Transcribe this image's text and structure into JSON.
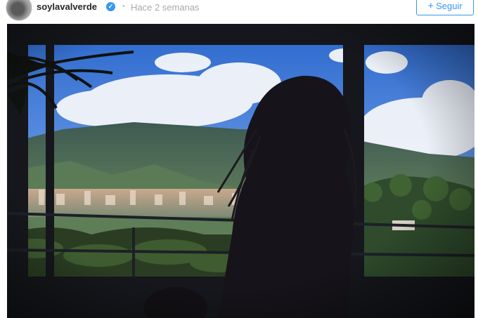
{
  "post": {
    "username": "soylavalverde",
    "verified": true,
    "separator": "•",
    "timestamp": "Hace 2 semanas",
    "follow_label": "Seguir",
    "follow_icon": "plus-icon"
  },
  "photo": {
    "subject": "silhouette-of-woman-at-window",
    "colors": {
      "sky_top": "#2f6fd3",
      "sky_bottom": "#8ab4ef",
      "mountain": "#4f6a5c",
      "frame": "#1a1c22"
    }
  },
  "colors": {
    "accent": "#3897f0",
    "username": "#262626",
    "muted": "#a8a8a8"
  }
}
